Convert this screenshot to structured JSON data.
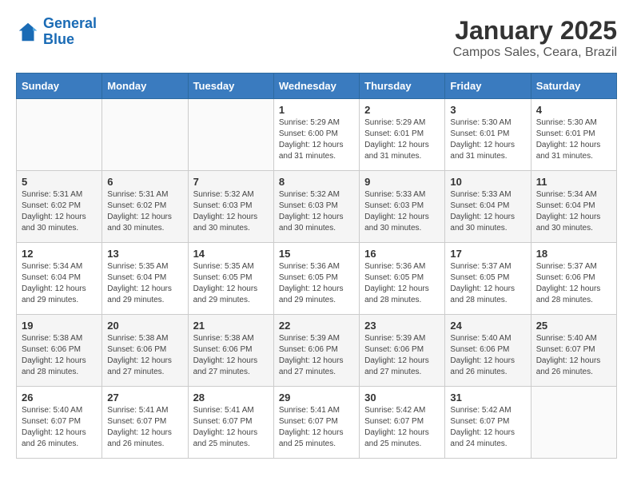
{
  "logo": {
    "line1": "General",
    "line2": "Blue"
  },
  "title": "January 2025",
  "subtitle": "Campos Sales, Ceara, Brazil",
  "days_of_week": [
    "Sunday",
    "Monday",
    "Tuesday",
    "Wednesday",
    "Thursday",
    "Friday",
    "Saturday"
  ],
  "weeks": [
    [
      {
        "day": "",
        "info": ""
      },
      {
        "day": "",
        "info": ""
      },
      {
        "day": "",
        "info": ""
      },
      {
        "day": "1",
        "info": "Sunrise: 5:29 AM\nSunset: 6:00 PM\nDaylight: 12 hours and 31 minutes."
      },
      {
        "day": "2",
        "info": "Sunrise: 5:29 AM\nSunset: 6:01 PM\nDaylight: 12 hours and 31 minutes."
      },
      {
        "day": "3",
        "info": "Sunrise: 5:30 AM\nSunset: 6:01 PM\nDaylight: 12 hours and 31 minutes."
      },
      {
        "day": "4",
        "info": "Sunrise: 5:30 AM\nSunset: 6:01 PM\nDaylight: 12 hours and 31 minutes."
      }
    ],
    [
      {
        "day": "5",
        "info": "Sunrise: 5:31 AM\nSunset: 6:02 PM\nDaylight: 12 hours and 30 minutes."
      },
      {
        "day": "6",
        "info": "Sunrise: 5:31 AM\nSunset: 6:02 PM\nDaylight: 12 hours and 30 minutes."
      },
      {
        "day": "7",
        "info": "Sunrise: 5:32 AM\nSunset: 6:03 PM\nDaylight: 12 hours and 30 minutes."
      },
      {
        "day": "8",
        "info": "Sunrise: 5:32 AM\nSunset: 6:03 PM\nDaylight: 12 hours and 30 minutes."
      },
      {
        "day": "9",
        "info": "Sunrise: 5:33 AM\nSunset: 6:03 PM\nDaylight: 12 hours and 30 minutes."
      },
      {
        "day": "10",
        "info": "Sunrise: 5:33 AM\nSunset: 6:04 PM\nDaylight: 12 hours and 30 minutes."
      },
      {
        "day": "11",
        "info": "Sunrise: 5:34 AM\nSunset: 6:04 PM\nDaylight: 12 hours and 30 minutes."
      }
    ],
    [
      {
        "day": "12",
        "info": "Sunrise: 5:34 AM\nSunset: 6:04 PM\nDaylight: 12 hours and 29 minutes."
      },
      {
        "day": "13",
        "info": "Sunrise: 5:35 AM\nSunset: 6:04 PM\nDaylight: 12 hours and 29 minutes."
      },
      {
        "day": "14",
        "info": "Sunrise: 5:35 AM\nSunset: 6:05 PM\nDaylight: 12 hours and 29 minutes."
      },
      {
        "day": "15",
        "info": "Sunrise: 5:36 AM\nSunset: 6:05 PM\nDaylight: 12 hours and 29 minutes."
      },
      {
        "day": "16",
        "info": "Sunrise: 5:36 AM\nSunset: 6:05 PM\nDaylight: 12 hours and 28 minutes."
      },
      {
        "day": "17",
        "info": "Sunrise: 5:37 AM\nSunset: 6:05 PM\nDaylight: 12 hours and 28 minutes."
      },
      {
        "day": "18",
        "info": "Sunrise: 5:37 AM\nSunset: 6:06 PM\nDaylight: 12 hours and 28 minutes."
      }
    ],
    [
      {
        "day": "19",
        "info": "Sunrise: 5:38 AM\nSunset: 6:06 PM\nDaylight: 12 hours and 28 minutes."
      },
      {
        "day": "20",
        "info": "Sunrise: 5:38 AM\nSunset: 6:06 PM\nDaylight: 12 hours and 27 minutes."
      },
      {
        "day": "21",
        "info": "Sunrise: 5:38 AM\nSunset: 6:06 PM\nDaylight: 12 hours and 27 minutes."
      },
      {
        "day": "22",
        "info": "Sunrise: 5:39 AM\nSunset: 6:06 PM\nDaylight: 12 hours and 27 minutes."
      },
      {
        "day": "23",
        "info": "Sunrise: 5:39 AM\nSunset: 6:06 PM\nDaylight: 12 hours and 27 minutes."
      },
      {
        "day": "24",
        "info": "Sunrise: 5:40 AM\nSunset: 6:06 PM\nDaylight: 12 hours and 26 minutes."
      },
      {
        "day": "25",
        "info": "Sunrise: 5:40 AM\nSunset: 6:07 PM\nDaylight: 12 hours and 26 minutes."
      }
    ],
    [
      {
        "day": "26",
        "info": "Sunrise: 5:40 AM\nSunset: 6:07 PM\nDaylight: 12 hours and 26 minutes."
      },
      {
        "day": "27",
        "info": "Sunrise: 5:41 AM\nSunset: 6:07 PM\nDaylight: 12 hours and 26 minutes."
      },
      {
        "day": "28",
        "info": "Sunrise: 5:41 AM\nSunset: 6:07 PM\nDaylight: 12 hours and 25 minutes."
      },
      {
        "day": "29",
        "info": "Sunrise: 5:41 AM\nSunset: 6:07 PM\nDaylight: 12 hours and 25 minutes."
      },
      {
        "day": "30",
        "info": "Sunrise: 5:42 AM\nSunset: 6:07 PM\nDaylight: 12 hours and 25 minutes."
      },
      {
        "day": "31",
        "info": "Sunrise: 5:42 AM\nSunset: 6:07 PM\nDaylight: 12 hours and 24 minutes."
      },
      {
        "day": "",
        "info": ""
      }
    ]
  ]
}
